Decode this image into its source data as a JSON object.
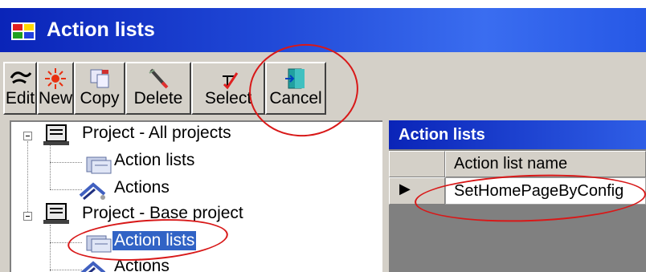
{
  "window": {
    "title": "Action lists"
  },
  "toolbar": {
    "buttons": [
      {
        "label": "Edit",
        "icon": "edit-icon"
      },
      {
        "label": "New",
        "icon": "new-icon"
      },
      {
        "label": "Copy",
        "icon": "copy-icon"
      },
      {
        "label": "Delete",
        "icon": "delete-icon"
      },
      {
        "label": "Select",
        "icon": "select-icon"
      },
      {
        "label": "Cancel",
        "icon": "exit-icon"
      }
    ]
  },
  "tree": {
    "nodes": [
      {
        "label": "Project - All projects",
        "icon": "project-icon"
      },
      {
        "label": "Action lists",
        "icon": "action-list-icon"
      },
      {
        "label": "Actions",
        "icon": "actions-icon"
      },
      {
        "label": "Project - Base project",
        "icon": "project-icon"
      },
      {
        "label": "Action lists",
        "icon": "action-list-icon",
        "selected": true
      },
      {
        "label": "Actions",
        "icon": "actions-icon"
      }
    ]
  },
  "grid": {
    "title": "Action lists",
    "column_header": "Action list name",
    "rows": [
      {
        "value": "SetHomePageByConfig",
        "current": true
      }
    ],
    "row_indicator": "▶"
  },
  "colors": {
    "titlebar": "#0a24b8",
    "selection": "#3163c5",
    "annotation": "#d81818",
    "chrome": "#d4d0c8"
  }
}
